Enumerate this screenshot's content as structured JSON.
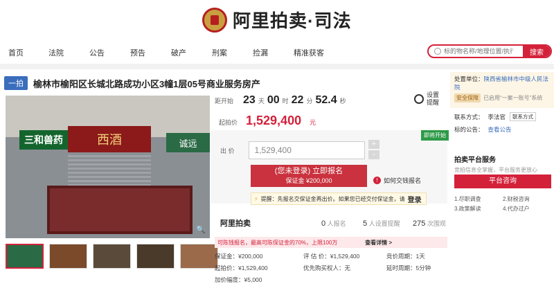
{
  "header": {
    "logo_text": "阿里拍卖·司法",
    "search_placeholder": "标的物名称/地理位置/执行案号",
    "search_button": "搜索"
  },
  "nav": [
    "首页",
    "法院",
    "公告",
    "预告",
    "破产",
    "刑案",
    "捡漏",
    "精准获客"
  ],
  "item": {
    "tag": "一拍",
    "title": "榆林市榆阳区长城北路成功小区3幢1层05号商业服务房产"
  },
  "photo": {
    "sign1": "三和兽药",
    "sign2": "西酒",
    "sign3": "诚远"
  },
  "countdown": {
    "label": "距开始",
    "days": "23",
    "days_unit": "天",
    "hours": "00",
    "hours_unit": "时",
    "minutes": "22",
    "minutes_unit": "分",
    "seconds": "52.4",
    "seconds_unit": "秒",
    "set_reminder": "设置提醒"
  },
  "start_price": {
    "label": "起拍价",
    "value": "1,529,400",
    "unit": "元"
  },
  "bid": {
    "badge": "即将开始",
    "label": "出 价",
    "value": "1,529,400",
    "plus": "+",
    "minus": "-",
    "register": "(您未登录) 立即报名",
    "deposit": "保证金 ¥200,000",
    "how_pay": "如何交钱报名",
    "notice": "提醒：先报名交保证金再出价。如果您已经交付保证金，请",
    "notice_login": "登录"
  },
  "stats": {
    "brand": "阿里拍卖",
    "signups": "0",
    "signups_label": "人报名",
    "reminders": "5",
    "reminders_label": "人设置提醒",
    "views": "275",
    "views_label": "次围观"
  },
  "warning": {
    "text": "可陈钱报名，最高可陈保证金的70%，上限100万",
    "more": "查看详情 >"
  },
  "info": {
    "deposit_label": "保证金：¥200,000",
    "appraisal": "评 估 价：¥1,529,400",
    "cycle": "竞价周期：1天",
    "start": "起拍价：¥1,529,400",
    "priority": "优先购买权人：无",
    "delay": "延时周期：5分钟",
    "increment": "加价幅度：¥5,000"
  },
  "right": {
    "org_label": "处置单位：",
    "org": "陕西省榆林市中级人民法院",
    "secure_badge": "安全保障",
    "secure_text": "已启用“一案一账号”系统",
    "contact_label": "联系方式：",
    "contact_name": "李法官",
    "contact_btn": "联系方式",
    "notice_label": "标的公告：",
    "notice_link": "查看公告",
    "platform_title": "拍卖平台服务",
    "platform_desc": "竞拍信息全掌握，平台服务更放心",
    "consult": "平台咨询",
    "svc1": "1.尽职调查",
    "svc2": "2.财税咨询",
    "svc3": "3.政策解读",
    "svc4": "4.代办过户"
  }
}
